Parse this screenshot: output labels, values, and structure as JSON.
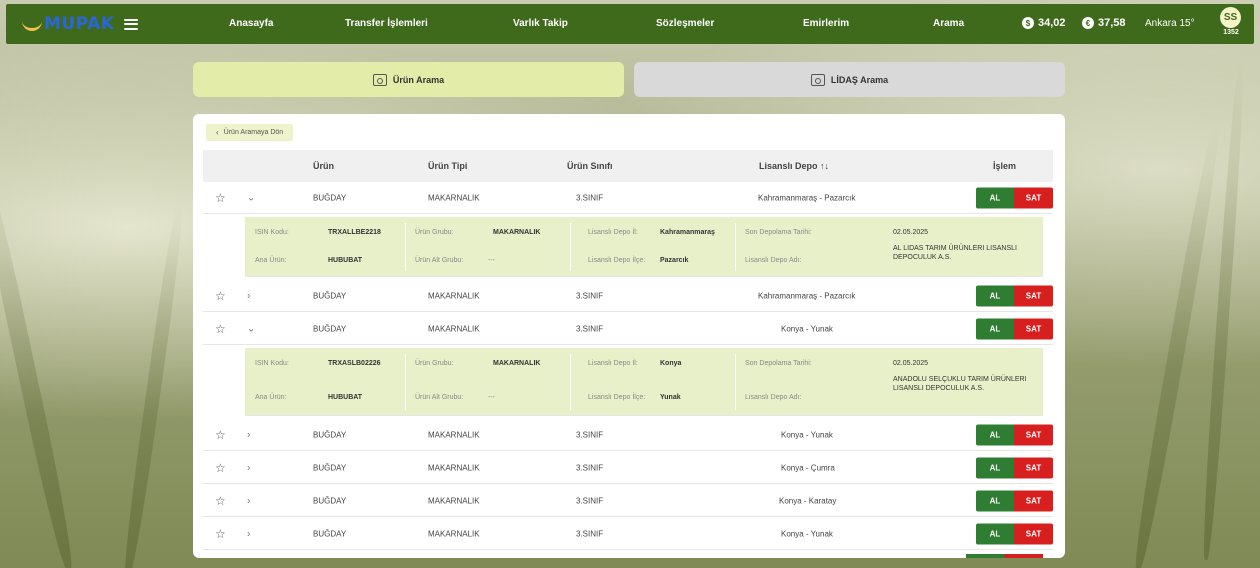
{
  "navbar": {
    "logo": "MUPAK",
    "items": [
      "Anasayfa",
      "Transfer İşlemleri",
      "Varlık Takip",
      "Sözleşmeler",
      "Emirlerim",
      "Arama"
    ],
    "currency_usd": "34,02",
    "currency_eur": "37,58",
    "weather": "Ankara 15°",
    "avatar_initials": "SS",
    "avatar_sub": "1352"
  },
  "tabs": {
    "urun": "Ürün Arama",
    "lidas": "LİDAŞ Arama"
  },
  "back_label": "Ürün Aramaya Dön",
  "table": {
    "headers": {
      "urun": "Ürün",
      "urun_tipi": "Ürün Tipi",
      "urun_sinifi": "Ürün Sınıfı",
      "lisansli_depo": "Lisanslı Depo ↑↓",
      "islem": "İşlem"
    },
    "al_label": "AL",
    "sat_label": "SAT",
    "rows": [
      {
        "urun": "BUĞDAY",
        "tip": "MAKARNALIK",
        "sinif": "3.SINIF",
        "depo": "Kahramanmaraş - Pazarcık",
        "expanded": true
      },
      {
        "urun": "BUĞDAY",
        "tip": "MAKARNALIK",
        "sinif": "3.SINIF",
        "depo": "Kahramanmaraş - Pazarcık",
        "expanded": false
      },
      {
        "urun": "BUĞDAY",
        "tip": "MAKARNALIK",
        "sinif": "3.SINIF",
        "depo": "Konya - Yunak",
        "expanded": true
      },
      {
        "urun": "BUĞDAY",
        "tip": "MAKARNALIK",
        "sinif": "3.SINIF",
        "depo": "Konya - Yunak",
        "expanded": false
      },
      {
        "urun": "BUĞDAY",
        "tip": "MAKARNALIK",
        "sinif": "3.SINIF",
        "depo": "Konya - Çumra",
        "expanded": false
      },
      {
        "urun": "BUĞDAY",
        "tip": "MAKARNALIK",
        "sinif": "3.SINIF",
        "depo": "Konya - Karatay",
        "expanded": false
      },
      {
        "urun": "BUĞDAY",
        "tip": "MAKARNALIK",
        "sinif": "3.SINIF",
        "depo": "Konya - Yunak",
        "expanded": false
      }
    ],
    "detail_labels": {
      "isin": "ISIN Kodu:",
      "ana_urun": "Ana Ürün:",
      "urun_grubu": "Ürün Grubu:",
      "urun_alt_grubu": "Ürün Alt Grubu:",
      "depo_il": "Lisanslı Depo İl:",
      "depo_ilce": "Lisanslı Depo İlçe:",
      "son_depolama": "Son Depolama Tarihi:",
      "depo_adi": "Lisanslı Depo Adı:"
    },
    "details": [
      {
        "isin": "TRXALLBE2218",
        "ana_urun": "HUBUBAT",
        "urun_grubu": "MAKARNALIK",
        "urun_alt_grubu": "---",
        "depo_il": "Kahramanmaraş",
        "depo_ilce": "Pazarcık",
        "son_depolama": "02.05.2025",
        "depo_adi": "AL LIDAS TARIM ÜRÜNLERI LISANSLI DEPOCULUK A.S."
      },
      {
        "isin": "TRXASLB02226",
        "ana_urun": "HUBUBAT",
        "urun_grubu": "MAKARNALIK",
        "urun_alt_grubu": "---",
        "depo_il": "Konya",
        "depo_ilce": "Yunak",
        "son_depolama": "02.05.2025",
        "depo_adi": "ANADOLU SELÇUKLU TARIM ÜRÜNLERI LISANSLI DEPOCULUK A.S."
      }
    ]
  },
  "colors": {
    "navbar": "#3f6a1b",
    "al": "#2e7d32",
    "sat": "#d71f1f",
    "active_tab": "#e4eca9",
    "detail_bg": "#e8f0c9"
  }
}
